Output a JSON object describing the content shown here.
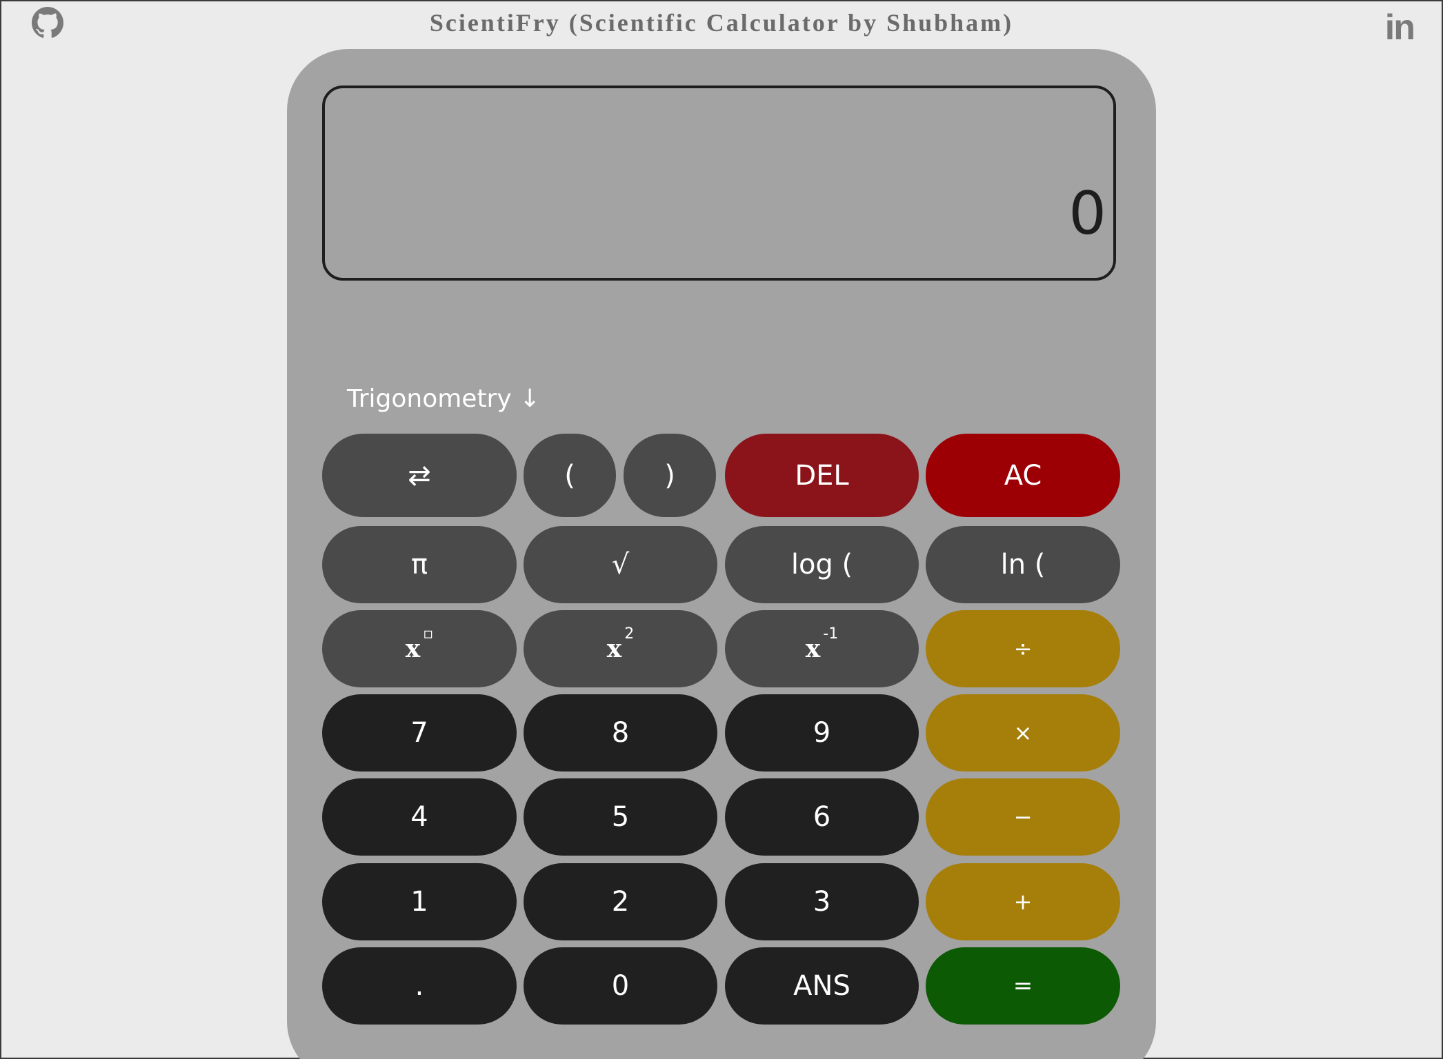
{
  "header": {
    "title": "ScientiFry (Scientific Calculator by Shubham)",
    "github_icon": "github-icon",
    "linkedin_label": "in"
  },
  "display": {
    "value": "0"
  },
  "trig_toggle": {
    "label": "Trigonometry ↓"
  },
  "buttons": {
    "swap": "⇄",
    "open_paren": "(",
    "close_paren": ")",
    "del": "DEL",
    "ac": "AC",
    "pi": "π",
    "sqrt": "√",
    "log": "log (",
    "ln": "ln (",
    "power_base": "x",
    "power_exp": "▫",
    "square_base": "x",
    "square_exp": "2",
    "inverse_base": "x",
    "inverse_exp": "-1",
    "divide": "÷",
    "multiply": "×",
    "minus": "−",
    "plus": "+",
    "equals": "=",
    "seven": "7",
    "eight": "8",
    "nine": "9",
    "four": "4",
    "five": "5",
    "six": "6",
    "one": "1",
    "two": "2",
    "three": "3",
    "dot": ".",
    "zero": "0",
    "ans": "ANS"
  },
  "colors": {
    "page_bg": "#ebebeb",
    "calculator_body": "#a3a3a3",
    "function_key": "#4a4a4a",
    "number_key": "#202020",
    "operator_key": "#a67f0b",
    "delete_key": "#8b141b",
    "clear_key": "#9c0005",
    "equals_key": "#0d5a05"
  }
}
